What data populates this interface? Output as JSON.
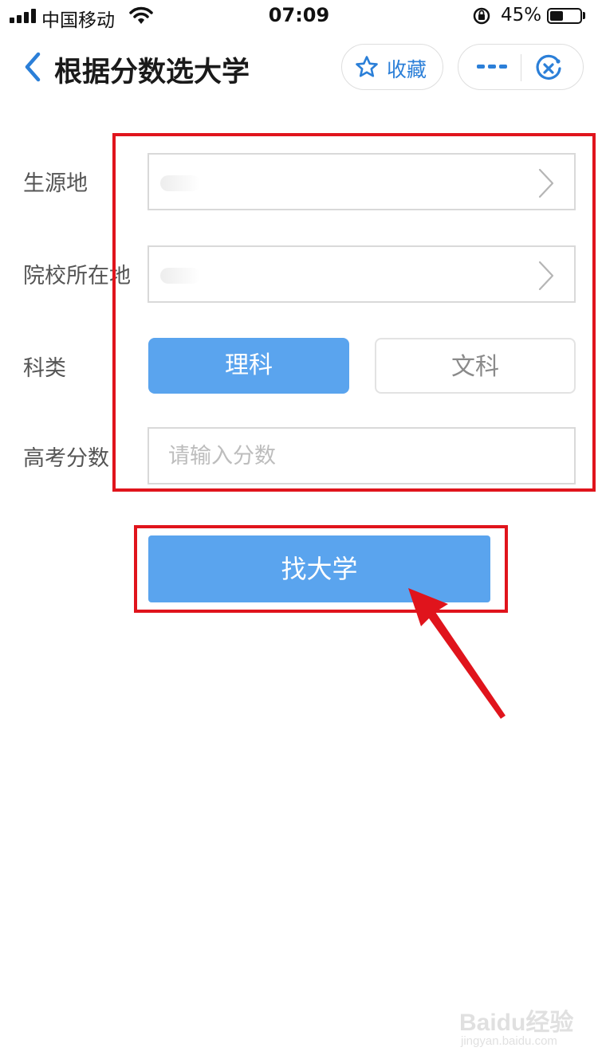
{
  "status_bar": {
    "carrier": "中国移动",
    "time": "07:09",
    "battery_percent_text": "45%",
    "battery_level": 0.45,
    "icons": [
      "signal-icon",
      "wifi-icon",
      "rotation-lock-icon",
      "battery-icon"
    ]
  },
  "nav": {
    "title": "根据分数选大学",
    "favorite_label": "收藏",
    "icons": [
      "back-icon",
      "star-icon",
      "more-icon",
      "close-icon"
    ]
  },
  "form": {
    "origin_label": "生源地",
    "origin_value": "",
    "school_location_label": "院校所在地",
    "school_location_value": "",
    "subject_label": "科类",
    "subject_options": [
      "理科",
      "文科"
    ],
    "subject_selected": "理科",
    "score_label": "高考分数",
    "score_placeholder": "请输入分数",
    "score_value": ""
  },
  "search_button_label": "找大学",
  "colors": {
    "accent": "#5aa4ee",
    "link": "#2b7fd8",
    "annotation": "#e0141c"
  },
  "watermark": {
    "brand": "Baidu经验",
    "url": "jingyan.baidu.com"
  }
}
